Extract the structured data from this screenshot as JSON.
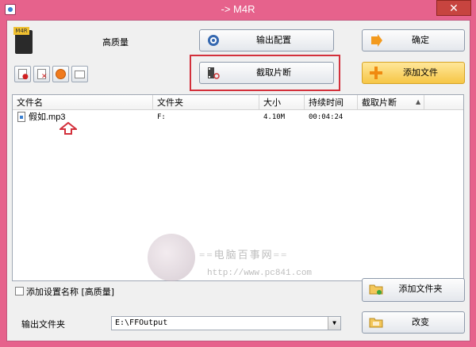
{
  "window": {
    "title": "-> M4R",
    "close": "✕"
  },
  "preset": {
    "icon_text": "M4R",
    "label": "高质量"
  },
  "buttons": {
    "output_config": "输出配置",
    "ok": "确定",
    "clip": "截取片断",
    "add_file": "添加文件",
    "add_folder": "添加文件夹",
    "change": "改变"
  },
  "file_list": {
    "columns": [
      "文件名",
      "文件夹",
      "大小",
      "持续时间",
      "截取片断"
    ],
    "rows": [
      {
        "name": "假如.mp3",
        "folder": "F:",
        "size": "4.10M",
        "duration": "00:04:24",
        "clip": ""
      }
    ]
  },
  "watermark": {
    "text": "==电脑百事网==",
    "url": "http://www.pc841.com"
  },
  "options": {
    "add_preset_name": "添加设置名称 [高质量]"
  },
  "output": {
    "label": "输出文件夹",
    "path": "E:\\FFOutput"
  },
  "colors": {
    "frame": "#e6628c",
    "highlight": "#d3303b"
  }
}
